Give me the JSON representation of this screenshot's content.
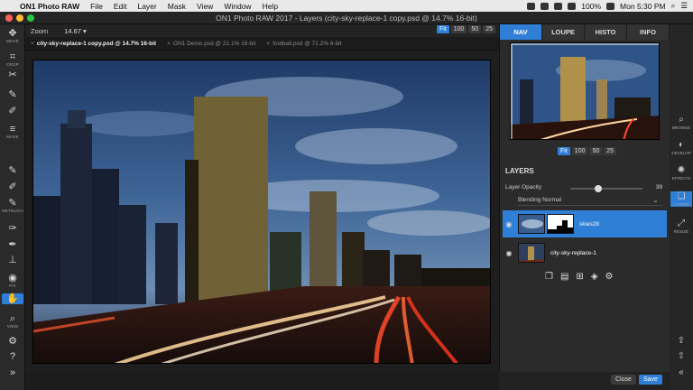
{
  "menubar": {
    "app_name": "ON1 Photo RAW",
    "items": [
      "File",
      "Edit",
      "Layer",
      "Mask",
      "View",
      "Window",
      "Help"
    ],
    "battery": "100%",
    "clock": "Mon 5:30 PM"
  },
  "window": {
    "title": "ON1 Photo RAW 2017 - Layers (city-sky-replace-1 copy.psd @ 14.7% 16-bit)"
  },
  "left_tools": [
    {
      "icon": "move-icon",
      "label": "MOVE"
    },
    {
      "icon": "crop-icon",
      "label": "CROP"
    },
    {
      "icon": "transform-icon",
      "label": ""
    },
    {
      "icon": "brush-icon",
      "label": ""
    },
    {
      "icon": "adjust-icon",
      "label": ""
    },
    {
      "icon": "line-mask-icon",
      "label": "MASK"
    },
    {
      "icon": "refine-brush-icon",
      "label": ""
    },
    {
      "icon": "chisel-icon",
      "label": ""
    },
    {
      "icon": "blur-icon",
      "label": "RETOUCH"
    },
    {
      "icon": "retouch-brush-icon",
      "label": ""
    },
    {
      "icon": "stamp-icon",
      "label": ""
    },
    {
      "icon": "red-eye-icon",
      "label": "FIX"
    },
    {
      "icon": "hand-icon",
      "label": ""
    },
    {
      "icon": "zoom-icon",
      "label": "VIEW"
    },
    {
      "icon": "gear-icon",
      "label": ""
    },
    {
      "icon": "help-icon",
      "label": ""
    },
    {
      "icon": "collapse-icon",
      "label": ""
    }
  ],
  "zoom": {
    "label": "Zoom",
    "value": "14.67",
    "buttons": [
      "Fit",
      "100",
      "50",
      "25"
    ],
    "selected": "Fit"
  },
  "file_tabs": [
    {
      "name": "city-sky-replace-1 copy.psd @ 14.7% 16-bit",
      "active": true
    },
    {
      "name": "ON1 Demo.psd @ 21.1% 16-bit",
      "active": false
    },
    {
      "name": "football.psd @ 71.2% 8-bit",
      "active": false
    }
  ],
  "right_panel": {
    "tabs": [
      "NAV",
      "LOUPE",
      "HISTO",
      "INFO"
    ],
    "selected_tab": "NAV",
    "nav_zoom_buttons": [
      "Fit",
      "100",
      "50",
      "25"
    ],
    "layers_title": "LAYERS",
    "opacity_label": "Layer Opacity",
    "opacity_value": "39",
    "opacity_fraction": 0.39,
    "blending_label": "Blending",
    "blending_value": "Normal",
    "layers": [
      {
        "name": "skies28",
        "selected": true
      },
      {
        "name": "city-sky-replace-1",
        "selected": false
      }
    ]
  },
  "modules": [
    {
      "icon": "browse-icon",
      "label": "BROWSE"
    },
    {
      "icon": "develop-icon",
      "label": "DEVELOP"
    },
    {
      "icon": "effects-icon",
      "label": "EFFECTS"
    },
    {
      "icon": "layers-icon",
      "label": "LAYERS",
      "selected": true
    },
    {
      "icon": "resize-icon",
      "label": "RESIZE"
    }
  ],
  "buttons": {
    "close": "Close",
    "save": "Save"
  },
  "colors": {
    "accent": "#2f7fd6",
    "panel_bg": "#2b2b2b",
    "menubar_bg": "#e9e9e9"
  }
}
